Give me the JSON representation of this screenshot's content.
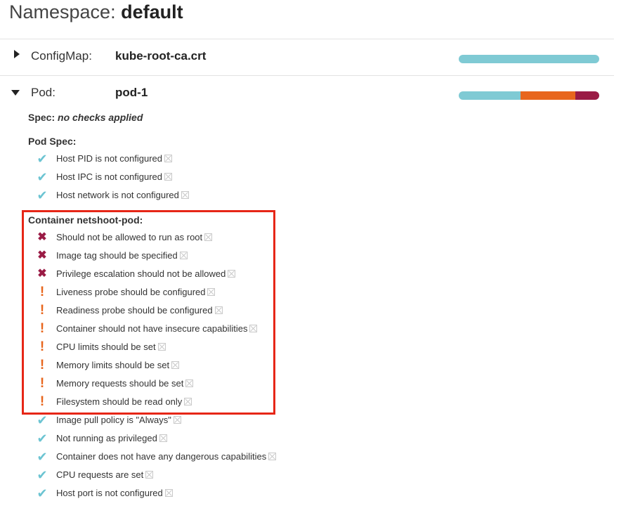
{
  "namespace": {
    "label": "Namespace:",
    "value": "default"
  },
  "resources": [
    {
      "kind": "ConfigMap:",
      "name": "kube-root-ca.crt",
      "expanded": false,
      "score": [
        {
          "status": "pass",
          "fraction": 1.0,
          "color": "#7fcad4"
        }
      ]
    },
    {
      "kind": "Pod:",
      "name": "pod-1",
      "expanded": true,
      "score": [
        {
          "status": "pass",
          "fraction": 0.44,
          "color": "#7fcad4"
        },
        {
          "status": "warning",
          "fraction": 0.39,
          "color": "#e8661d"
        },
        {
          "status": "danger",
          "fraction": 0.17,
          "color": "#9a1b45"
        }
      ]
    }
  ],
  "spec": {
    "label": "Spec:",
    "note": "no checks applied"
  },
  "pod_spec": {
    "label": "Pod Spec:",
    "checks": [
      {
        "status": "pass",
        "message": "Host PID is not configured"
      },
      {
        "status": "pass",
        "message": "Host IPC is not configured"
      },
      {
        "status": "pass",
        "message": "Host network is not configured"
      }
    ]
  },
  "container": {
    "label": "Container netshoot-pod:",
    "checks": [
      {
        "status": "danger",
        "message": "Should not be allowed to run as root"
      },
      {
        "status": "danger",
        "message": "Image tag should be specified"
      },
      {
        "status": "danger",
        "message": "Privilege escalation should not be allowed"
      },
      {
        "status": "warning",
        "message": "Liveness probe should be configured"
      },
      {
        "status": "warning",
        "message": "Readiness probe should be configured"
      },
      {
        "status": "warning",
        "message": "Container should not have insecure capabilities"
      },
      {
        "status": "warning",
        "message": "CPU limits should be set"
      },
      {
        "status": "warning",
        "message": "Memory limits should be set"
      },
      {
        "status": "warning",
        "message": "Memory requests should be set"
      },
      {
        "status": "warning",
        "message": "Filesystem should be read only"
      },
      {
        "status": "pass",
        "message": "Image pull policy is \"Always\""
      },
      {
        "status": "pass",
        "message": "Not running as privileged"
      },
      {
        "status": "pass",
        "message": "Container does not have any dangerous capabilities"
      },
      {
        "status": "pass",
        "message": "CPU requests are set"
      },
      {
        "status": "pass",
        "message": "Host port is not configured"
      }
    ]
  },
  "icons": {
    "pass": "checkmark-icon",
    "danger": "x-icon",
    "warning": "exclamation-icon",
    "details": "details-icon"
  },
  "highlight_color": "#e62617"
}
